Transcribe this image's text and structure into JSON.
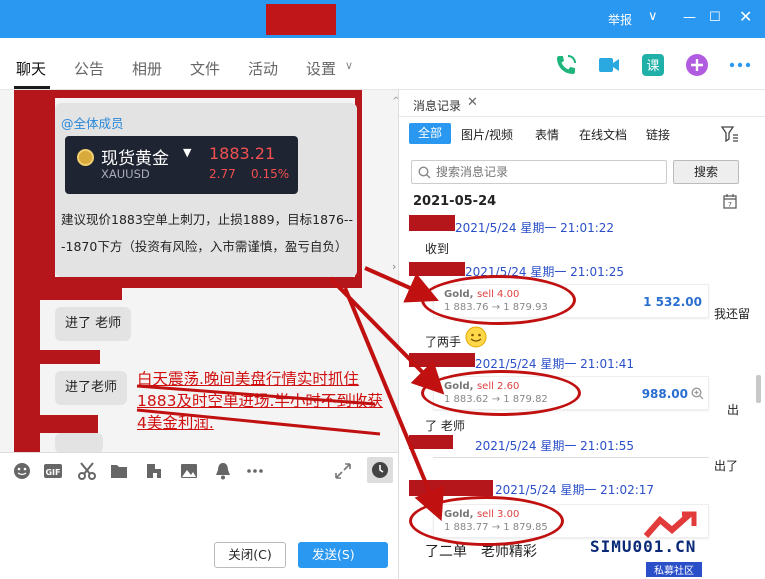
{
  "titlebar": {
    "report": "举报",
    "min": "—",
    "max": "☐",
    "close": "✕",
    "down": "∨"
  },
  "tabs": [
    "聊天",
    "公告",
    "相册",
    "文件",
    "活动",
    "设置"
  ],
  "tab_settings_caret": "∨",
  "chat": {
    "mention": "@全体成员",
    "gold": {
      "name": "现货黄金",
      "symbol": "XAUUSD",
      "price": "1883.21",
      "change": "2.77",
      "pct": "0.15%"
    },
    "bubble_text": "建议现价1883空单上刺刀，止损1889，目标1876---1870下方（投资有风险，入市需谨慎，盈亏自负）",
    "msg1": "进了 老师",
    "msg2": "进了老师",
    "annotation": "白天震荡.晚间美盘行情实时抓住1883及时空单进场.半小时不到收获4美金利润."
  },
  "composer": {
    "close_label": "关闭(C)",
    "send_label": "发送(S)"
  },
  "history": {
    "title": "消息记录",
    "filters": [
      "全部",
      "图片/视频",
      "表情",
      "在线文档",
      "链接"
    ],
    "search_placeholder": "搜索消息记录",
    "search_btn": "搜索",
    "date": "2021-05-24",
    "stamps": [
      "2021/5/24 星期一 21:01:22",
      "2021/5/24 星期一 21:01:25",
      "2021/5/24 星期一 21:01:41",
      "2021/5/24 星期一 21:01:55",
      "2021/5/24 星期一 21:02:17"
    ],
    "msg_received": "收到",
    "msg_two": "了两手",
    "msg_teacher": "了 老师",
    "side_texts": [
      "我还留",
      "出",
      "出了"
    ],
    "bottom_partial": "了二单　老师精彩",
    "cards": [
      {
        "title": "Gold, ",
        "sell": "sell 4.00",
        "prices": "1 883.76 → 1 879.93",
        "value": "1 532.00"
      },
      {
        "title": "Gold, ",
        "sell": "sell 2.60",
        "prices": "1 883.62 → 1 879.82",
        "value": "988.00"
      },
      {
        "title": "Gold, ",
        "sell": "sell 3.00",
        "prices": "1 883.77 → 1 879.85",
        "value": ""
      }
    ]
  },
  "watermark": {
    "text": "SIMU001.CN",
    "sub": "私募社区"
  },
  "colors": {
    "accent": "#2a97f0",
    "redact": "#b5161b",
    "annot": "#d01010",
    "stamp": "#2a4fc8"
  }
}
